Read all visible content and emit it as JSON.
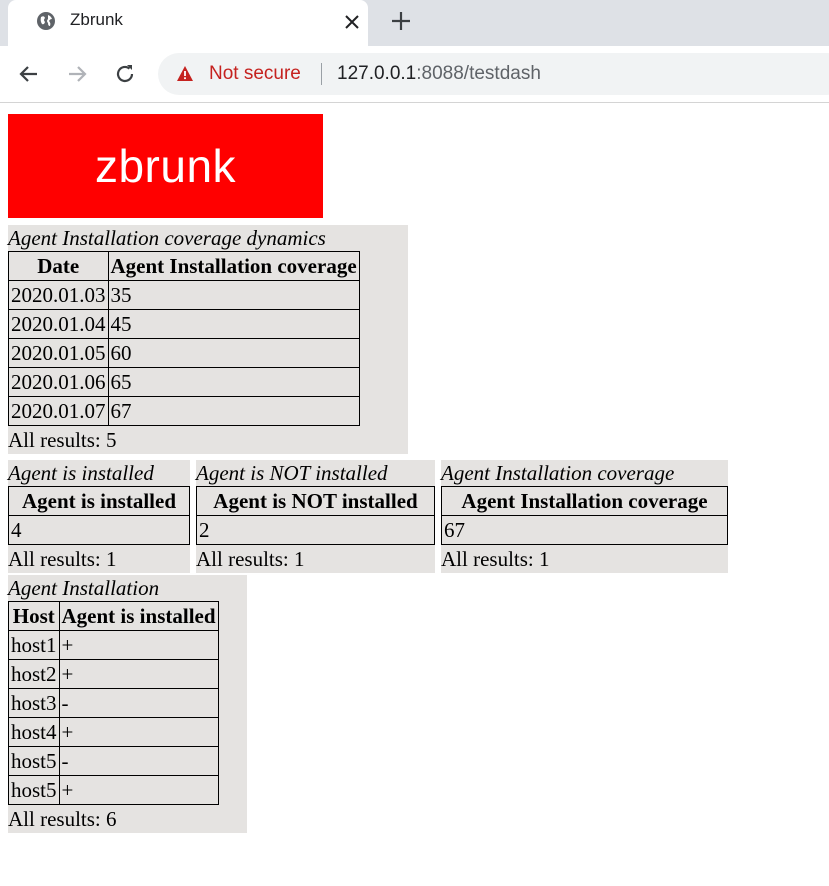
{
  "browser": {
    "tab_title": "Zbrunk",
    "security_label": "Not secure",
    "url_host": "127.0.0.1",
    "url_rest": ":8088/testdash"
  },
  "logo": {
    "text": "zbrunk",
    "background": "#ff0000"
  },
  "icons": {
    "favicon": "globe-icon",
    "close": "close-icon",
    "new_tab": "plus-icon",
    "back": "back-arrow-icon",
    "forward": "forward-arrow-icon",
    "reload": "reload-icon",
    "security": "warning-icon"
  },
  "widgets": {
    "coverage_dynamics": {
      "caption": "Agent Installation coverage dynamics",
      "headers": [
        "Date",
        "Agent Installation coverage"
      ],
      "rows": [
        [
          "2020.01.03",
          "35"
        ],
        [
          "2020.01.04",
          "45"
        ],
        [
          "2020.01.05",
          "60"
        ],
        [
          "2020.01.06",
          "65"
        ],
        [
          "2020.01.07",
          "67"
        ]
      ],
      "footer": "All results: 5"
    },
    "installed": {
      "caption": "Agent is installed",
      "headers": [
        "Agent is installed"
      ],
      "rows": [
        [
          "4"
        ]
      ],
      "footer": "All results: 1"
    },
    "not_installed": {
      "caption": "Agent is NOT installed",
      "headers": [
        "Agent is NOT installed"
      ],
      "rows": [
        [
          "2"
        ]
      ],
      "footer": "All results: 1"
    },
    "coverage": {
      "caption": "Agent Installation coverage",
      "headers": [
        "Agent Installation coverage"
      ],
      "rows": [
        [
          "67"
        ]
      ],
      "footer": "All results: 1"
    },
    "installation": {
      "caption": "Agent Installation",
      "headers": [
        "Host",
        "Agent is installed"
      ],
      "rows": [
        [
          "host1",
          "+"
        ],
        [
          "host2",
          "+"
        ],
        [
          "host3",
          "-"
        ],
        [
          "host4",
          "+"
        ],
        [
          "host5",
          "-"
        ],
        [
          "host5",
          "+"
        ]
      ],
      "footer": "All results: 6"
    }
  },
  "colors": {
    "widget_background": "#e5e3e1",
    "tabstrip": "#dee1e6",
    "security_warning": "#c5221f"
  }
}
